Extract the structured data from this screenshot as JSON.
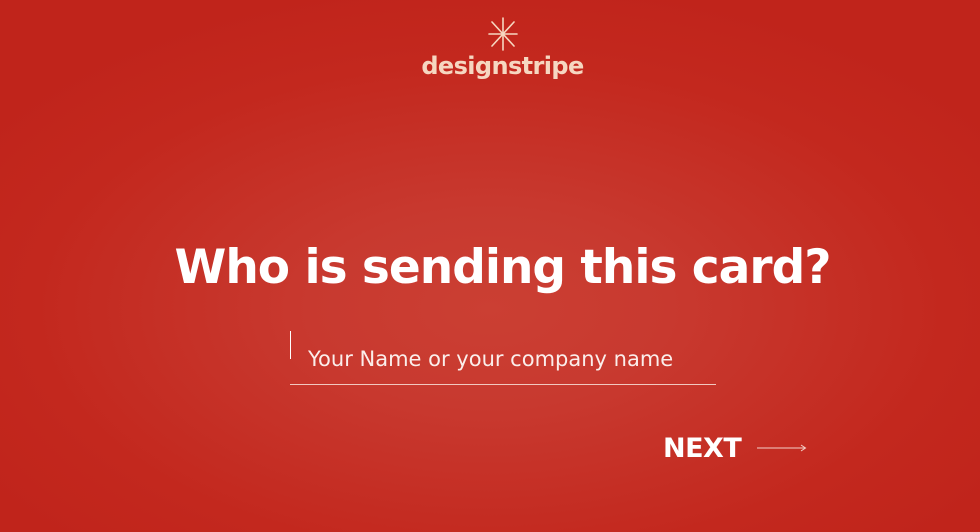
{
  "brand": {
    "name": "designstripe",
    "mark_icon": "asterisk-spark-icon",
    "text_color": "#f6d7c1"
  },
  "heading": "Who is sending this card?",
  "name_field": {
    "value": "",
    "placeholder": "Your Name or your company name"
  },
  "next_button": {
    "label": "NEXT",
    "icon": "arrow-right-icon"
  },
  "colors": {
    "background": "#c3281e",
    "background_glow": "#cb3f33",
    "text": "#ffffff"
  }
}
